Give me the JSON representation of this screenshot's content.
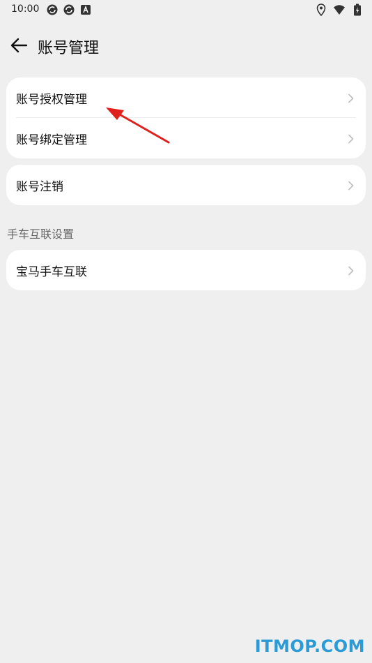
{
  "status_bar": {
    "time": "10:00",
    "left_icons": [
      "sync-icon",
      "sync-icon",
      "app-notification-icon"
    ],
    "right_icons": [
      "location-icon",
      "wifi-icon",
      "battery-charging-icon"
    ]
  },
  "header": {
    "back_icon": "arrow-left-icon",
    "title": "账号管理"
  },
  "groups": [
    {
      "items": [
        {
          "label": "账号授权管理"
        },
        {
          "label": "账号绑定管理"
        }
      ]
    },
    {
      "items": [
        {
          "label": "账号注销"
        }
      ]
    }
  ],
  "section": {
    "title": "手车互联设置",
    "items": [
      {
        "label": "宝马手车互联"
      }
    ]
  },
  "annotation": {
    "arrow_color": "#e0201c"
  },
  "watermark": {
    "text": "ITMOP.COM",
    "color": "#2a9bd6"
  },
  "colors": {
    "background": "#efefef",
    "card": "#ffffff"
  }
}
